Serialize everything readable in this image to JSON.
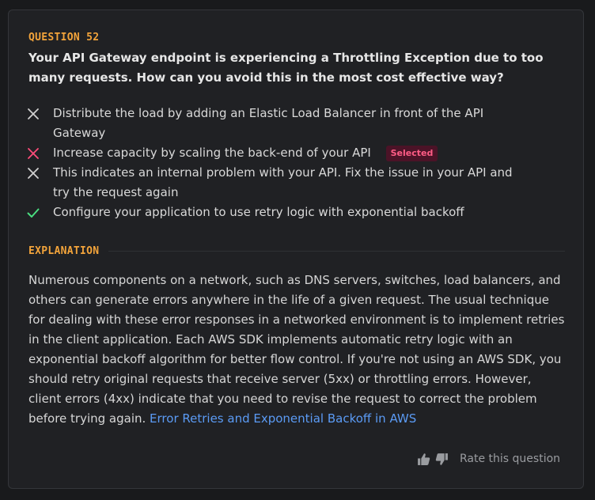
{
  "question": {
    "label": "QUESTION 52",
    "text": "Your API Gateway endpoint is experiencing a Throttling Exception due to too many requests. How can you avoid this in the most cost effective way?"
  },
  "options": [
    {
      "text": "Distribute the load by adding an Elastic Load Balancer in front of the API Gateway",
      "mark": "x-icon",
      "selected": false
    },
    {
      "text": "Increase capacity by scaling the back-end of your API",
      "mark": "x-icon",
      "selected": true
    },
    {
      "text": "This indicates an internal problem with your API. Fix the issue in your API and try the request again",
      "mark": "x-icon",
      "selected": false
    },
    {
      "text": "Configure your application to use retry logic with exponential backoff",
      "mark": "check-icon",
      "selected": false
    }
  ],
  "selected_badge": "Selected",
  "explanation": {
    "label": "EXPLANATION",
    "text": "Numerous components on a network, such as DNS servers, switches, load balancers, and others can generate errors anywhere in the life of a given request. The usual technique for dealing with these error responses in a networked environment is to implement retries in the client application. Each AWS SDK implements automatic retry logic with an exponential backoff algorithm for better flow control. If you're not using an AWS SDK, you should retry original requests that receive server (5xx) or throttling errors. However, client errors (4xx) indicate that you need to revise the request to correct the problem before trying again. ",
    "link_text": "Error Retries and Exponential Backoff in AWS"
  },
  "rating": {
    "label": "Rate this question",
    "up_icon": "thumbs-up-icon",
    "down_icon": "thumbs-down-icon"
  },
  "colors": {
    "accent": "#f3a43b",
    "wrong_selected": "#ff4d7a",
    "wrong": "#d0d0d0",
    "correct": "#4ade80",
    "link": "#5b9bf5"
  }
}
